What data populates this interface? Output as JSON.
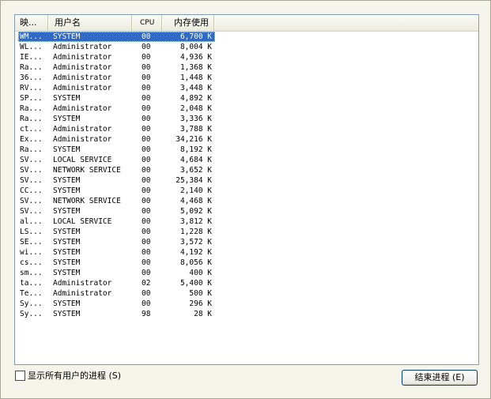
{
  "columns": {
    "image": "映...",
    "user": "用户名",
    "cpu": "CPU",
    "mem": "内存使用"
  },
  "processes": [
    {
      "image": "WM...",
      "user": "SYSTEM",
      "cpu": "00",
      "mem": "6,700 K",
      "selected": true
    },
    {
      "image": "WL...",
      "user": "Administrator",
      "cpu": "00",
      "mem": "8,004 K"
    },
    {
      "image": "IE...",
      "user": "Administrator",
      "cpu": "00",
      "mem": "4,936 K"
    },
    {
      "image": "Ra...",
      "user": "Administrator",
      "cpu": "00",
      "mem": "1,368 K"
    },
    {
      "image": "36...",
      "user": "Administrator",
      "cpu": "00",
      "mem": "1,448 K"
    },
    {
      "image": "RV...",
      "user": "Administrator",
      "cpu": "00",
      "mem": "3,448 K"
    },
    {
      "image": "SP...",
      "user": "SYSTEM",
      "cpu": "00",
      "mem": "4,892 K"
    },
    {
      "image": "Ra...",
      "user": "Administrator",
      "cpu": "00",
      "mem": "2,048 K"
    },
    {
      "image": "Ra...",
      "user": "SYSTEM",
      "cpu": "00",
      "mem": "3,336 K"
    },
    {
      "image": "ct...",
      "user": "Administrator",
      "cpu": "00",
      "mem": "3,788 K"
    },
    {
      "image": "Ex...",
      "user": "Administrator",
      "cpu": "00",
      "mem": "34,216 K"
    },
    {
      "image": "Ra...",
      "user": "SYSTEM",
      "cpu": "00",
      "mem": "8,192 K"
    },
    {
      "image": "SV...",
      "user": "LOCAL SERVICE",
      "cpu": "00",
      "mem": "4,684 K"
    },
    {
      "image": "SV...",
      "user": "NETWORK SERVICE",
      "cpu": "00",
      "mem": "3,652 K"
    },
    {
      "image": "SV...",
      "user": "SYSTEM",
      "cpu": "00",
      "mem": "25,384 K"
    },
    {
      "image": "CC...",
      "user": "SYSTEM",
      "cpu": "00",
      "mem": "2,140 K"
    },
    {
      "image": "SV...",
      "user": "NETWORK SERVICE",
      "cpu": "00",
      "mem": "4,468 K"
    },
    {
      "image": "SV...",
      "user": "SYSTEM",
      "cpu": "00",
      "mem": "5,092 K"
    },
    {
      "image": "al...",
      "user": "LOCAL SERVICE",
      "cpu": "00",
      "mem": "3,812 K"
    },
    {
      "image": "LS...",
      "user": "SYSTEM",
      "cpu": "00",
      "mem": "1,228 K"
    },
    {
      "image": "SE...",
      "user": "SYSTEM",
      "cpu": "00",
      "mem": "3,572 K"
    },
    {
      "image": "wi...",
      "user": "SYSTEM",
      "cpu": "00",
      "mem": "4,192 K"
    },
    {
      "image": "cs...",
      "user": "SYSTEM",
      "cpu": "00",
      "mem": "8,056 K"
    },
    {
      "image": "sm...",
      "user": "SYSTEM",
      "cpu": "00",
      "mem": "400 K"
    },
    {
      "image": "ta...",
      "user": "Administrator",
      "cpu": "02",
      "mem": "5,400 K"
    },
    {
      "image": "Te...",
      "user": "Administrator",
      "cpu": "00",
      "mem": "500 K"
    },
    {
      "image": "Sy...",
      "user": "SYSTEM",
      "cpu": "00",
      "mem": "296 K"
    },
    {
      "image": "Sy...",
      "user": "SYSTEM",
      "cpu": "98",
      "mem": "28 K"
    }
  ],
  "show_all_users": {
    "label": "显示所有用户的进程 (S)",
    "checked": false
  },
  "end_process_button": "结束进程 (E)",
  "colors": {
    "selection": "#316AC5",
    "background": "#ECE9D8"
  }
}
